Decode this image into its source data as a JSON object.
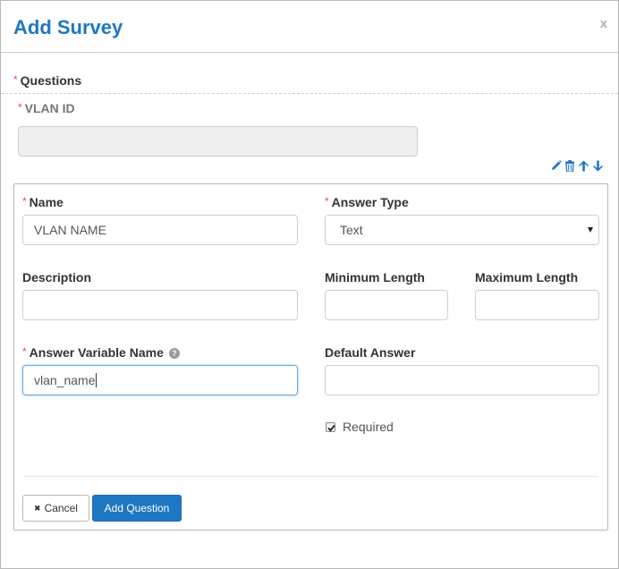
{
  "modal": {
    "title": "Add Survey",
    "close_label": "x"
  },
  "survey": {
    "questions_label": "Questions",
    "prev_question_label": "VLAN ID",
    "prev_question_value": ""
  },
  "question_actions": {
    "icons": [
      "pencil-icon",
      "trash-icon",
      "arrow-up-icon",
      "arrow-down-icon"
    ]
  },
  "form": {
    "name_label": "Name",
    "name_value": "VLAN NAME",
    "answer_type_label": "Answer Type",
    "answer_type_value": "Text",
    "description_label": "Description",
    "description_value": "",
    "min_length_label": "Minimum Length",
    "min_length_value": "",
    "max_length_label": "Maximum Length",
    "max_length_value": "",
    "variable_label": "Answer Variable Name",
    "variable_value": "vlan_name",
    "help_glyph": "?",
    "default_label": "Default Answer",
    "default_value": "",
    "required_label": "Required",
    "required_checked": true
  },
  "buttons": {
    "cancel_label": "Cancel",
    "cancel_glyph": "✖",
    "add_label": "Add Question"
  },
  "colors": {
    "accent": "#1e77c3",
    "required_star": "#d9534f",
    "focus_border": "#66a9e0"
  }
}
